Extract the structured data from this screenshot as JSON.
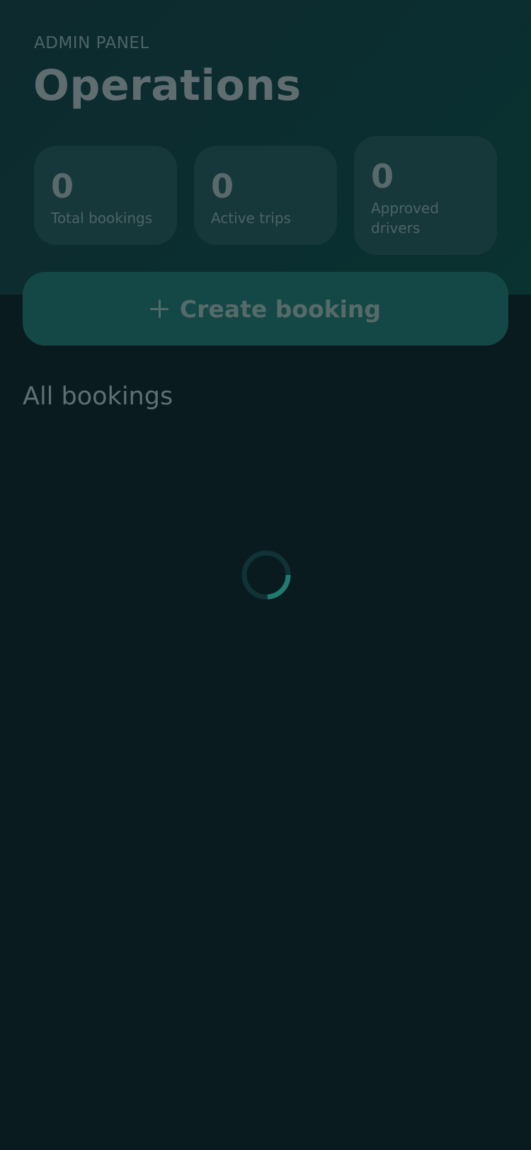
{
  "header": {
    "eyebrow": "ADMIN PANEL",
    "title": "Operations"
  },
  "stats": [
    {
      "value": "0",
      "label": "Total bookings"
    },
    {
      "value": "0",
      "label": "Active trips"
    },
    {
      "value": "0",
      "label": "Approved drivers"
    }
  ],
  "actions": {
    "create_label": "Create booking",
    "create_icon": "plus-icon"
  },
  "bookings": {
    "section_title": "All bookings",
    "loading_indicator": "spinner"
  },
  "colors": {
    "background": "#0a1b20",
    "header": "#0b2e30",
    "card": "#17383b",
    "accent": "#1f7a70"
  }
}
